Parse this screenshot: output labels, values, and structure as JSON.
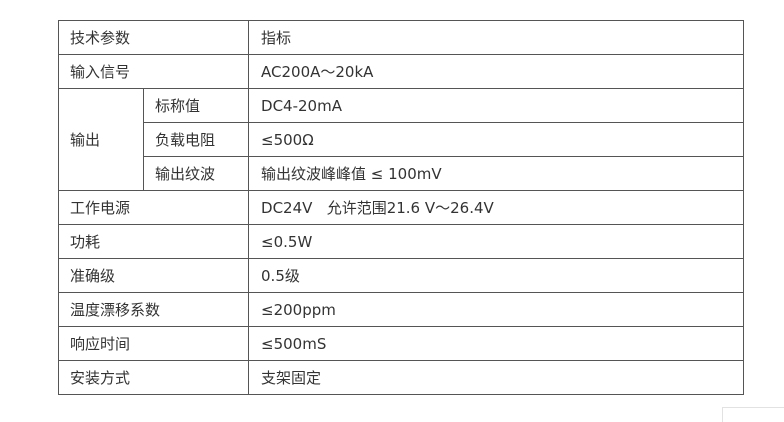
{
  "table": {
    "header": {
      "param": "技术参数",
      "spec": "指标"
    },
    "input": {
      "label": "输入信号",
      "value": "AC200A～20kA"
    },
    "output": {
      "label": "输出",
      "rated": {
        "label": "标称值",
        "value": "DC4-20mA"
      },
      "load": {
        "label": "负载电阻",
        "value": "≤500Ω"
      },
      "ripple": {
        "label": "输出纹波",
        "value": "输出纹波峰峰值 ≤ 100mV"
      }
    },
    "power_supply": {
      "label": "工作电源",
      "value": "DC24V   允许范围21.6 V～26.4V"
    },
    "power_consumption": {
      "label": "功耗",
      "value": "≤0.5W"
    },
    "accuracy": {
      "label": "准确级",
      "value": "0.5级"
    },
    "temp_drift": {
      "label": "温度漂移系数",
      "value": "≤200ppm"
    },
    "response_time": {
      "label": "响应时间",
      "value": "≤500mS"
    },
    "mounting": {
      "label": "安装方式",
      "value": "支架固定"
    }
  }
}
